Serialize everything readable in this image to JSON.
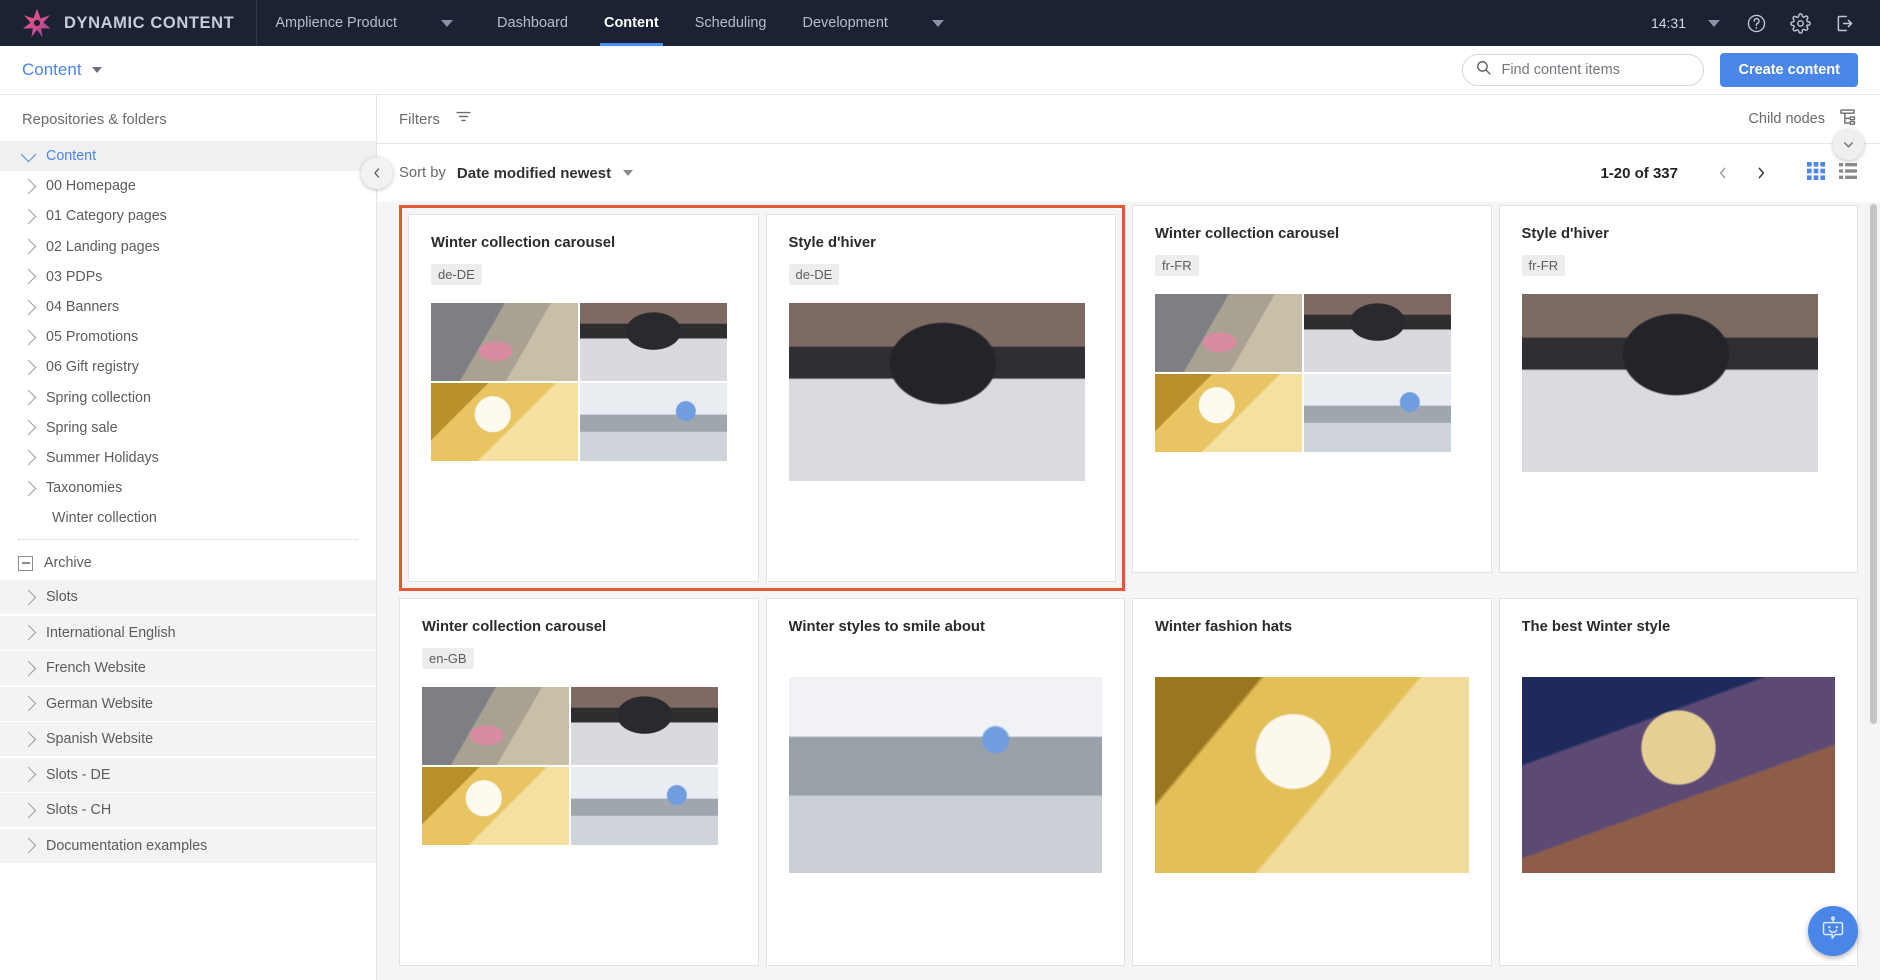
{
  "topnav": {
    "logo_text": "DYNAMIC CONTENT",
    "logo_icon": "amplience-star-icon",
    "product_label": "Amplience Product",
    "product_caret_icon": "chevron-down-icon",
    "items": [
      {
        "label": "Dashboard",
        "active": false
      },
      {
        "label": "Content",
        "active": true
      },
      {
        "label": "Scheduling",
        "active": false
      },
      {
        "label": "Development",
        "active": false
      }
    ],
    "dev_caret_icon": "chevron-down-icon",
    "clock": "14:31",
    "clock_caret_icon": "chevron-down-icon",
    "help_icon": "help-circle-icon",
    "settings_icon": "gear-icon",
    "logout_icon": "sign-out-icon"
  },
  "subheader": {
    "breadcrumb": "Content",
    "breadcrumb_caret_icon": "chevron-down-icon",
    "search": {
      "icon": "search-icon",
      "value": "",
      "placeholder": "Find content items"
    },
    "create_button": "Create content"
  },
  "sidebar": {
    "title": "Repositories & folders",
    "tree": [
      {
        "label": "Content",
        "type": "selected-root",
        "icon": "chevron-down-icon"
      },
      {
        "label": "00 Homepage",
        "type": "folder",
        "icon": "chevron-right-icon"
      },
      {
        "label": "01 Category pages",
        "type": "folder",
        "icon": "chevron-right-icon"
      },
      {
        "label": "02 Landing pages",
        "type": "folder",
        "icon": "chevron-right-icon"
      },
      {
        "label": "03 PDPs",
        "type": "folder",
        "icon": "chevron-right-icon"
      },
      {
        "label": "04 Banners",
        "type": "folder",
        "icon": "chevron-right-icon"
      },
      {
        "label": "05 Promotions",
        "type": "folder",
        "icon": "chevron-right-icon"
      },
      {
        "label": "06 Gift registry",
        "type": "folder",
        "icon": "chevron-right-icon"
      },
      {
        "label": "Spring collection",
        "type": "folder",
        "icon": "chevron-right-icon"
      },
      {
        "label": "Spring sale",
        "type": "folder",
        "icon": "chevron-right-icon"
      },
      {
        "label": "Summer Holidays",
        "type": "folder",
        "icon": "chevron-right-icon"
      },
      {
        "label": "Taxonomies",
        "type": "folder",
        "icon": "chevron-right-icon"
      },
      {
        "label": "Winter collection",
        "type": "leaf",
        "icon": "none"
      }
    ],
    "archive": {
      "label": "Archive",
      "icon": "minus-box-icon"
    },
    "repositories": [
      {
        "label": "Slots",
        "icon": "chevron-right-icon"
      },
      {
        "label": "International English",
        "icon": "chevron-right-icon"
      },
      {
        "label": "French Website",
        "icon": "chevron-right-icon"
      },
      {
        "label": "German Website",
        "icon": "chevron-right-icon"
      },
      {
        "label": "Spanish Website",
        "icon": "chevron-right-icon"
      },
      {
        "label": "Slots - DE",
        "icon": "chevron-right-icon"
      },
      {
        "label": "Slots - CH",
        "icon": "chevron-right-icon"
      },
      {
        "label": "Documentation examples",
        "icon": "chevron-right-icon"
      }
    ]
  },
  "toolbar": {
    "filters_label": "Filters",
    "filters_icon": "filter-icon",
    "child_nodes_label": "Child nodes",
    "child_nodes_icon": "hierarchy-icon",
    "expand_icon": "chevron-down-icon",
    "collapse_sidebar_icon": "chevron-left-icon",
    "sort_label": "Sort by",
    "sort_value": "Date modified newest",
    "sort_caret_icon": "chevron-down-icon",
    "pagination": "1-20 of 337",
    "prev_icon": "chevron-left-icon",
    "next_icon": "chevron-right-icon",
    "grid_view_icon": "grid-view-icon",
    "list_view_icon": "list-view-icon",
    "active_view": "grid"
  },
  "colors": {
    "accent_blue": "#4a86e8",
    "selection_orange": "#e05a33",
    "topnav_bg": "#1b2233"
  },
  "cards": [
    {
      "title": "Winter collection carousel",
      "locale": "de-DE",
      "thumb": "quad",
      "selected": true
    },
    {
      "title": "Style d'hiver",
      "locale": "de-DE",
      "thumb": "single",
      "selected": true
    },
    {
      "title": "Winter collection carousel",
      "locale": "fr-FR",
      "thumb": "quad",
      "selected": false
    },
    {
      "title": "Style d'hiver",
      "locale": "fr-FR",
      "thumb": "single",
      "selected": false
    },
    {
      "title": "Winter collection carousel",
      "locale": "en-GB",
      "thumb": "quad",
      "selected": false
    },
    {
      "title": "Winter styles to smile about",
      "locale": "",
      "thumb": "w-selfie",
      "selected": false
    },
    {
      "title": "Winter fashion hats",
      "locale": "",
      "thumb": "w-hat",
      "selected": false
    },
    {
      "title": "The best Winter style",
      "locale": "",
      "thumb": "w-best",
      "selected": false
    }
  ],
  "chat": {
    "icon": "chatbot-icon"
  }
}
